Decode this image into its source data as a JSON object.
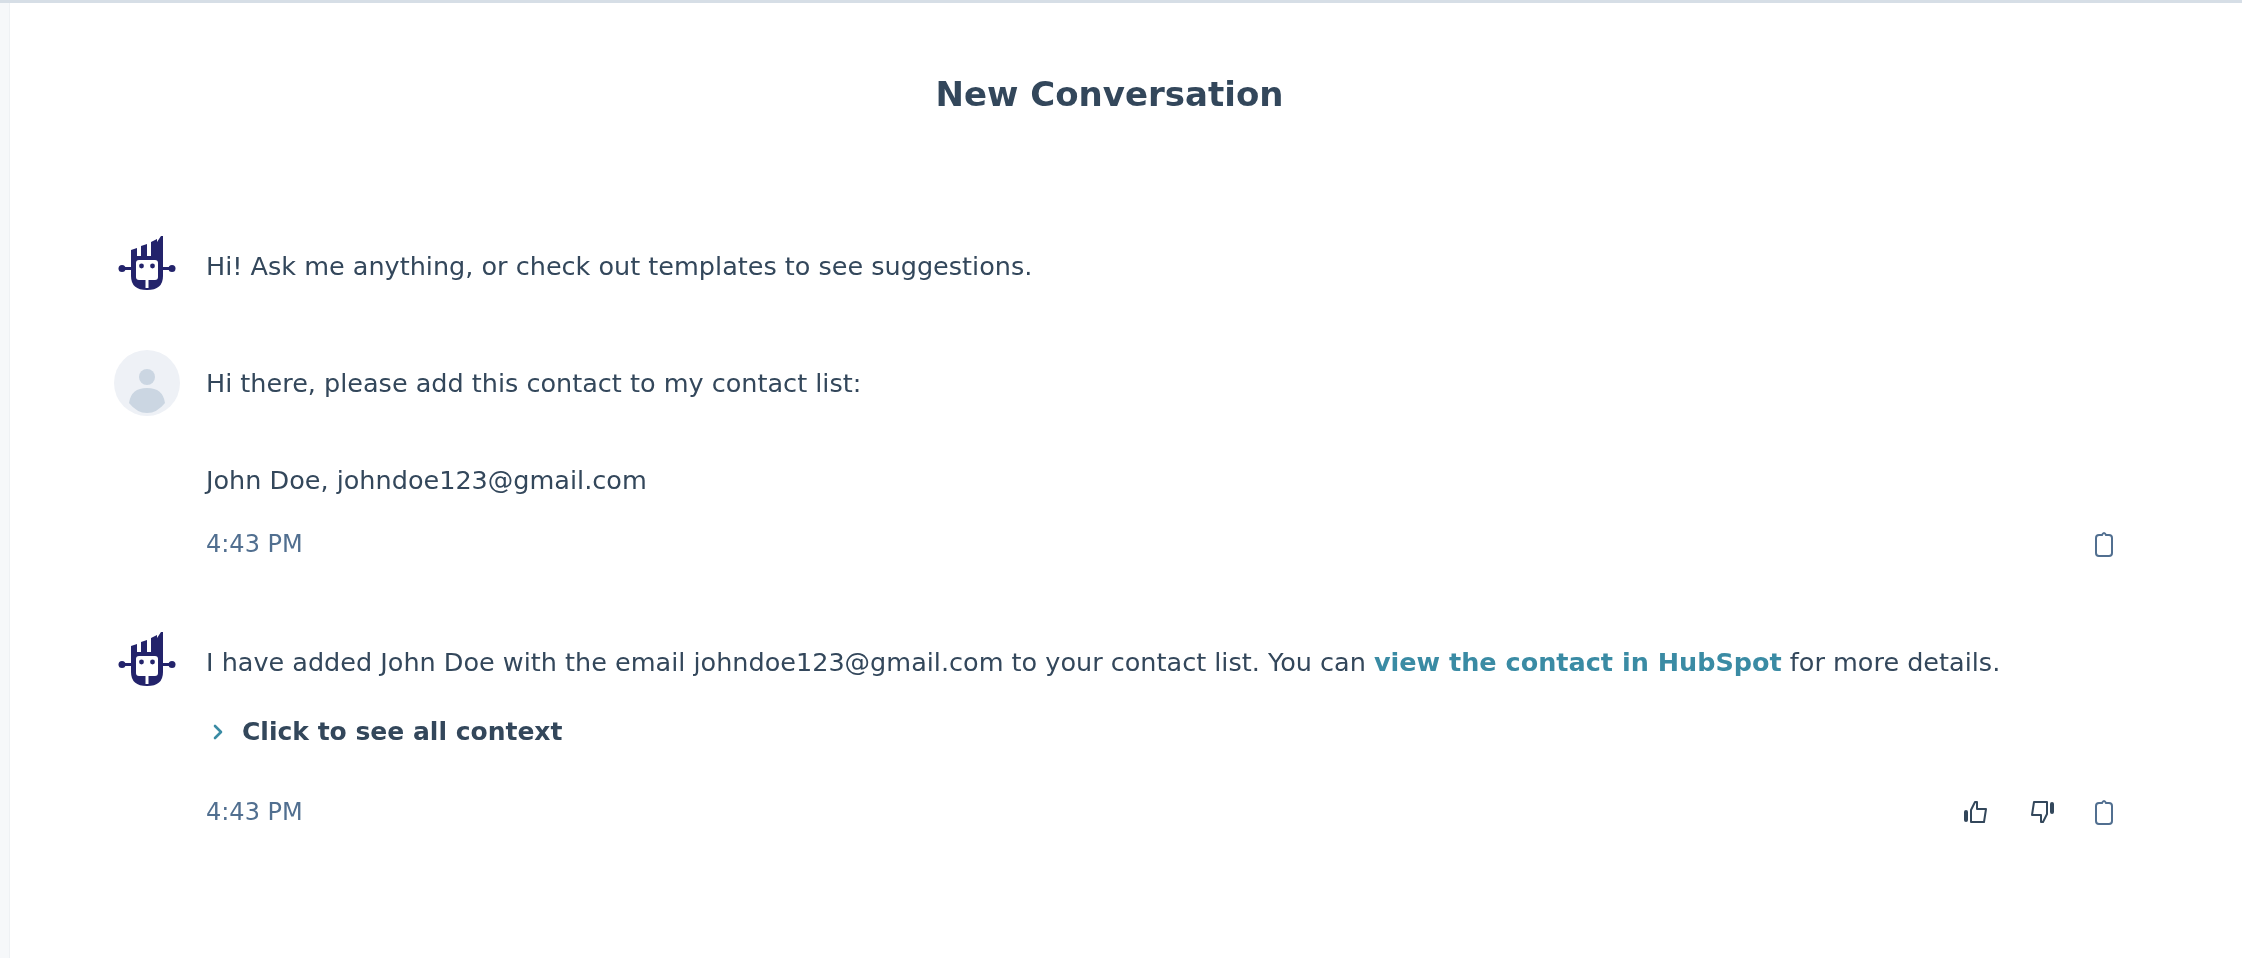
{
  "header": {
    "title": "New Conversation"
  },
  "messages": [
    {
      "kind": "bot",
      "paragraphs": [
        {
          "text": "Hi! Ask me anything, or check out templates to see suggestions."
        }
      ]
    },
    {
      "kind": "user",
      "paragraphs": [
        {
          "text": "Hi there, please add this contact to my contact list:"
        },
        {
          "text": "John Doe, johndoe123@gmail.com"
        }
      ],
      "time": "4:43 PM",
      "actions": [
        {
          "kind": "copy"
        }
      ]
    },
    {
      "kind": "bot",
      "paragraphs": [
        {
          "text": "I have added John Doe with the email johndoe123@gmail.com to your contact list. You can ",
          "link": "view the contact in HubSpot",
          "after": " for more details."
        }
      ],
      "context_toggle": {
        "label": "Click to see all context",
        "expanded": false
      },
      "time": "4:43 PM",
      "actions": [
        {
          "kind": "like"
        },
        {
          "kind": "dislike"
        },
        {
          "kind": "copy"
        }
      ]
    }
  ]
}
